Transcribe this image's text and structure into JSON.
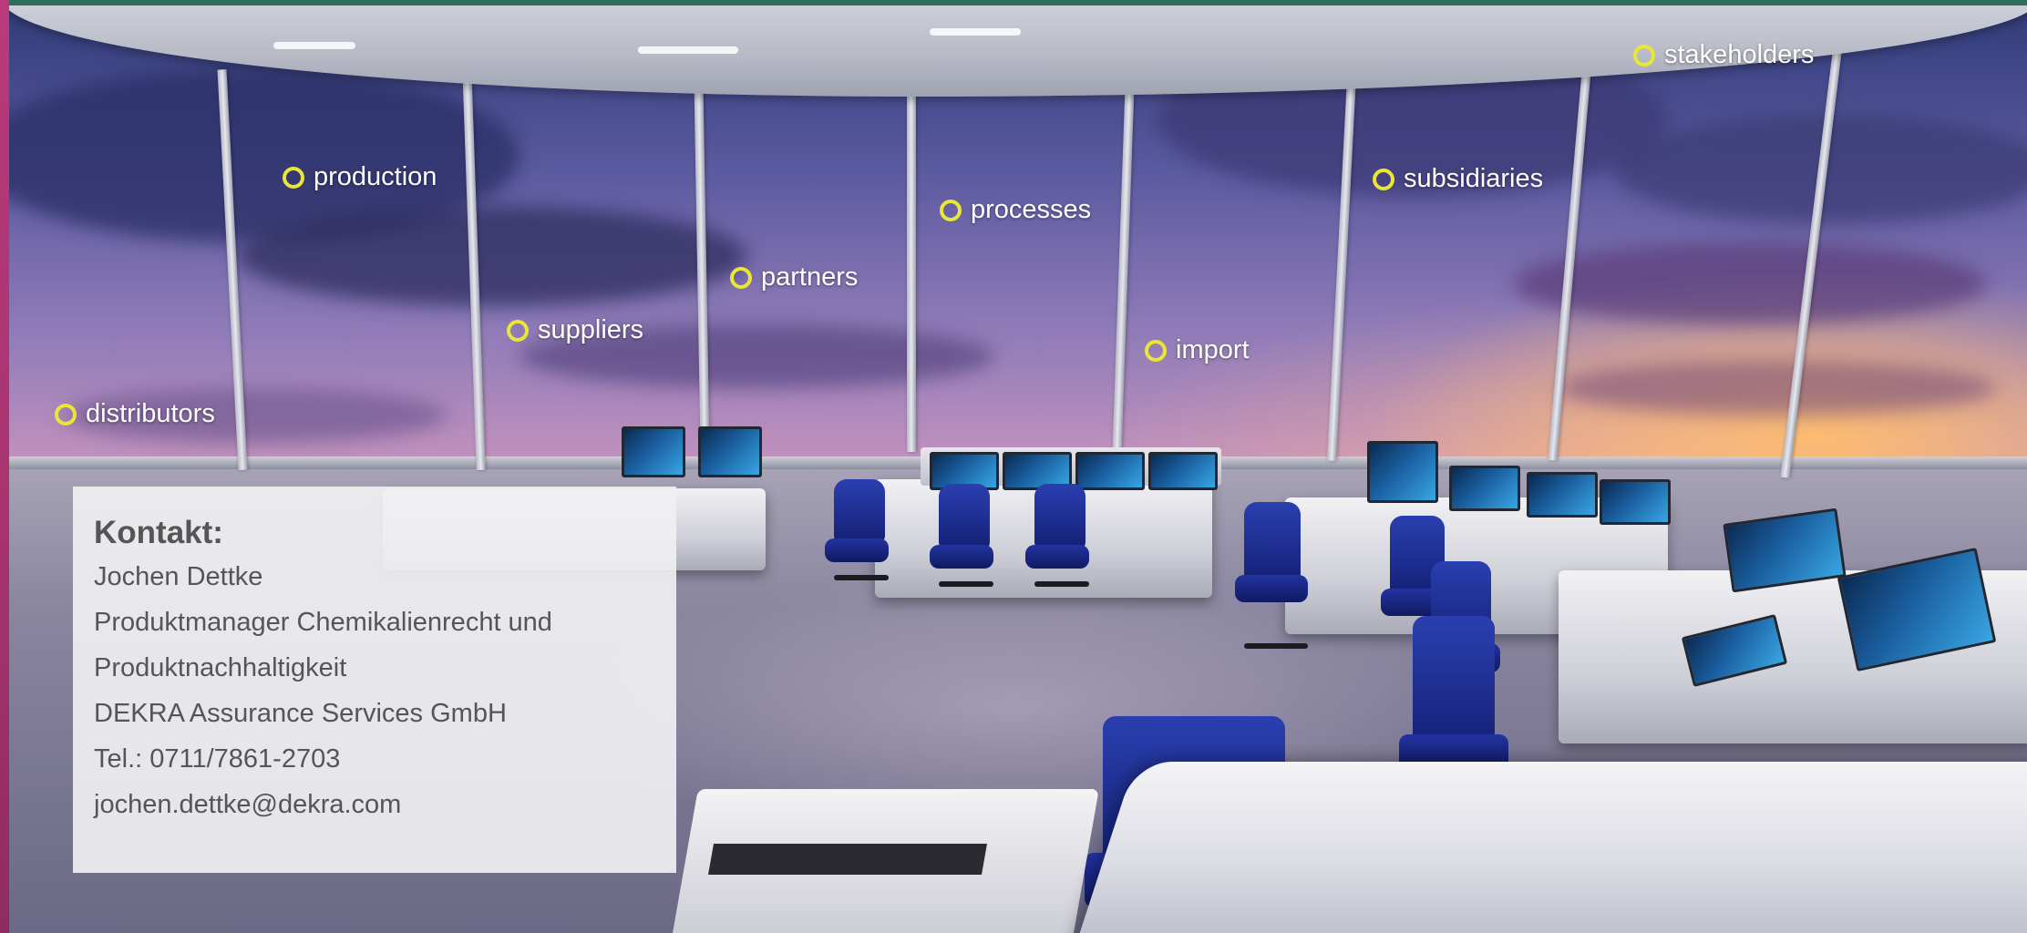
{
  "labels": {
    "stakeholders": "stakeholders",
    "production": "production",
    "subsidiaries": "subsidiaries",
    "processes": "processes",
    "partners": "partners",
    "suppliers": "suppliers",
    "import": "import",
    "distributors": "distributors"
  },
  "contact": {
    "heading": "Kontakt:",
    "name": "Jochen Dettke",
    "title_line1": "Produktmanager Chemikalienrecht und",
    "title_line2": "Produktnachhaltigkeit",
    "company": "DEKRA Assurance Services GmbH",
    "phone": "Tel.: 0711/7861-2703",
    "email": "jochen.dettke@dekra.com"
  },
  "colors": {
    "frame_left": "#b83a7a",
    "frame_top": "#2d6f59",
    "label_dot": "#e9e636",
    "chair": "#1f2f9a"
  }
}
